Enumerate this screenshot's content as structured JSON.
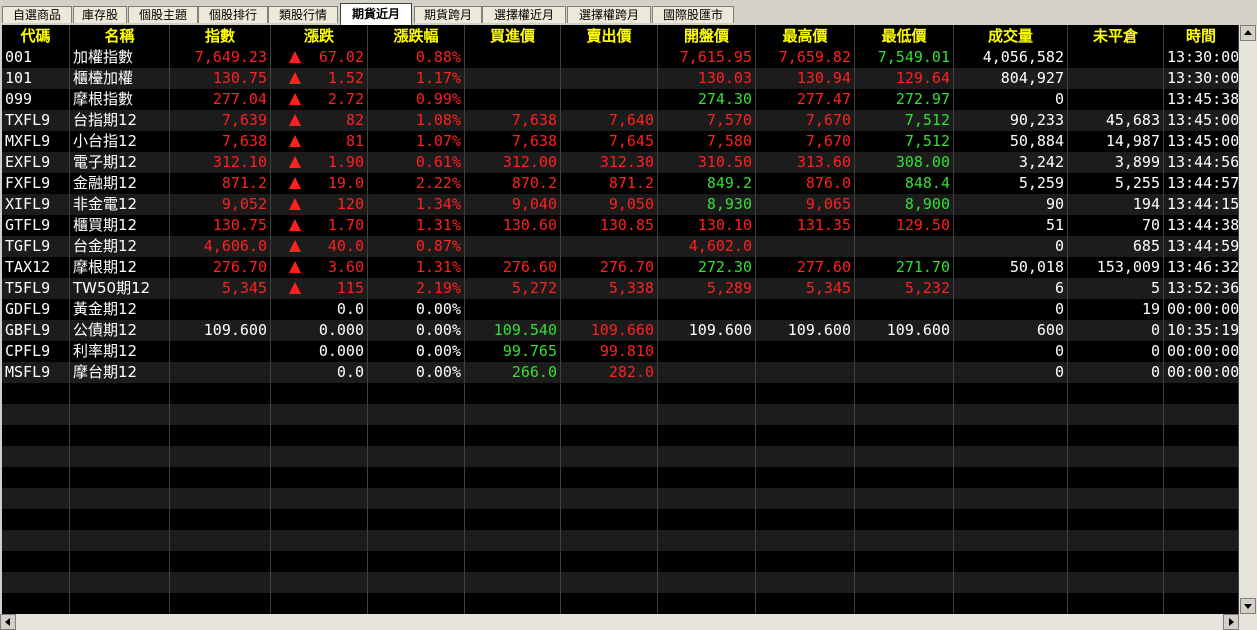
{
  "tabs": [
    {
      "label": "自選商品",
      "active": false
    },
    {
      "label": "庫存股",
      "active": false
    },
    {
      "label": "個股主題",
      "active": false
    },
    {
      "label": "個股排行",
      "active": false
    },
    {
      "label": "類股行情",
      "active": false
    },
    {
      "label": "期貨近月",
      "active": true
    },
    {
      "label": "期貨跨月",
      "active": false
    },
    {
      "label": "選擇權近月",
      "active": false
    },
    {
      "label": "選擇權跨月",
      "active": false
    },
    {
      "label": "國際股匯市",
      "active": false
    }
  ],
  "columns": [
    "代碼",
    "名稱",
    "指數",
    "漲跌",
    "漲跌幅",
    "買進價",
    "賣出價",
    "開盤價",
    "最高價",
    "最低價",
    "成交量",
    "未平倉",
    "時間"
  ],
  "colors": {
    "up": "#ff2020",
    "down": "#33e033",
    "flat": "#ffffff",
    "header": "#ffff00"
  },
  "rows": [
    {
      "code": "001",
      "name": "加權指數",
      "price": "7,649.23",
      "up": true,
      "change": "67.02",
      "pct": "0.88%",
      "bid": "",
      "ask": "",
      "open": "7,615.95",
      "high": "7,659.82",
      "low": "7,549.01",
      "volume": "4,056,582",
      "oi": "",
      "time": "13:30:00",
      "c": {
        "price": "red",
        "change": "red",
        "pct": "red",
        "bid": "white",
        "ask": "white",
        "open": "red",
        "high": "red",
        "low": "green"
      }
    },
    {
      "code": "101",
      "name": "櫃檯加權",
      "price": "130.75",
      "up": true,
      "change": "1.52",
      "pct": "1.17%",
      "bid": "",
      "ask": "",
      "open": "130.03",
      "high": "130.94",
      "low": "129.64",
      "volume": "804,927",
      "oi": "",
      "time": "13:30:00",
      "c": {
        "price": "red",
        "change": "red",
        "pct": "red",
        "bid": "white",
        "ask": "white",
        "open": "red",
        "high": "red",
        "low": "red"
      }
    },
    {
      "code": "099",
      "name": "摩根指數",
      "price": "277.04",
      "up": true,
      "change": "2.72",
      "pct": "0.99%",
      "bid": "",
      "ask": "",
      "open": "274.30",
      "high": "277.47",
      "low": "272.97",
      "volume": "0",
      "oi": "",
      "time": "13:45:38",
      "c": {
        "price": "red",
        "change": "red",
        "pct": "red",
        "bid": "white",
        "ask": "white",
        "open": "green",
        "high": "red",
        "low": "green"
      }
    },
    {
      "code": "TXFL9",
      "name": "台指期12",
      "price": "7,639",
      "up": true,
      "change": "82",
      "pct": "1.08%",
      "bid": "7,638",
      "ask": "7,640",
      "open": "7,570",
      "high": "7,670",
      "low": "7,512",
      "volume": "90,233",
      "oi": "45,683",
      "time": "13:45:00",
      "c": {
        "price": "red",
        "change": "red",
        "pct": "red",
        "bid": "red",
        "ask": "red",
        "open": "red",
        "high": "red",
        "low": "green"
      }
    },
    {
      "code": "MXFL9",
      "name": "小台指12",
      "price": "7,638",
      "up": true,
      "change": "81",
      "pct": "1.07%",
      "bid": "7,638",
      "ask": "7,645",
      "open": "7,580",
      "high": "7,670",
      "low": "7,512",
      "volume": "50,884",
      "oi": "14,987",
      "time": "13:45:00",
      "c": {
        "price": "red",
        "change": "red",
        "pct": "red",
        "bid": "red",
        "ask": "red",
        "open": "red",
        "high": "red",
        "low": "green"
      }
    },
    {
      "code": "EXFL9",
      "name": "電子期12",
      "price": "312.10",
      "up": true,
      "change": "1.90",
      "pct": "0.61%",
      "bid": "312.00",
      "ask": "312.30",
      "open": "310.50",
      "high": "313.60",
      "low": "308.00",
      "volume": "3,242",
      "oi": "3,899",
      "time": "13:44:56",
      "c": {
        "price": "red",
        "change": "red",
        "pct": "red",
        "bid": "red",
        "ask": "red",
        "open": "red",
        "high": "red",
        "low": "green"
      }
    },
    {
      "code": "FXFL9",
      "name": "金融期12",
      "price": "871.2",
      "up": true,
      "change": "19.0",
      "pct": "2.22%",
      "bid": "870.2",
      "ask": "871.2",
      "open": "849.2",
      "high": "876.0",
      "low": "848.4",
      "volume": "5,259",
      "oi": "5,255",
      "time": "13:44:57",
      "c": {
        "price": "red",
        "change": "red",
        "pct": "red",
        "bid": "red",
        "ask": "red",
        "open": "green",
        "high": "red",
        "low": "green"
      }
    },
    {
      "code": "XIFL9",
      "name": "非金電12",
      "price": "9,052",
      "up": true,
      "change": "120",
      "pct": "1.34%",
      "bid": "9,040",
      "ask": "9,050",
      "open": "8,930",
      "high": "9,065",
      "low": "8,900",
      "volume": "90",
      "oi": "194",
      "time": "13:44:15",
      "c": {
        "price": "red",
        "change": "red",
        "pct": "red",
        "bid": "red",
        "ask": "red",
        "open": "green",
        "high": "red",
        "low": "green"
      }
    },
    {
      "code": "GTFL9",
      "name": "櫃買期12",
      "price": "130.75",
      "up": true,
      "change": "1.70",
      "pct": "1.31%",
      "bid": "130.60",
      "ask": "130.85",
      "open": "130.10",
      "high": "131.35",
      "low": "129.50",
      "volume": "51",
      "oi": "70",
      "time": "13:44:38",
      "c": {
        "price": "red",
        "change": "red",
        "pct": "red",
        "bid": "red",
        "ask": "red",
        "open": "red",
        "high": "red",
        "low": "red"
      }
    },
    {
      "code": "TGFL9",
      "name": "台金期12",
      "price": "4,606.0",
      "up": true,
      "change": "40.0",
      "pct": "0.87%",
      "bid": "",
      "ask": "",
      "open": "4,602.0",
      "high": "",
      "low": "",
      "volume": "0",
      "oi": "685",
      "time": "13:44:59",
      "c": {
        "price": "red",
        "change": "red",
        "pct": "red",
        "bid": "white",
        "ask": "white",
        "open": "red",
        "high": "red",
        "low": "red"
      }
    },
    {
      "code": "TAX12",
      "name": "摩根期12",
      "price": "276.70",
      "up": true,
      "change": "3.60",
      "pct": "1.31%",
      "bid": "276.60",
      "ask": "276.70",
      "open": "272.30",
      "high": "277.60",
      "low": "271.70",
      "volume": "50,018",
      "oi": "153,009",
      "time": "13:46:32",
      "c": {
        "price": "red",
        "change": "red",
        "pct": "red",
        "bid": "red",
        "ask": "red",
        "open": "green",
        "high": "red",
        "low": "green"
      }
    },
    {
      "code": "T5FL9",
      "name": "TW50期12",
      "price": "5,345",
      "up": true,
      "change": "115",
      "pct": "2.19%",
      "bid": "5,272",
      "ask": "5,338",
      "open": "5,289",
      "high": "5,345",
      "low": "5,232",
      "volume": "6",
      "oi": "5",
      "time": "13:52:36",
      "c": {
        "price": "red",
        "change": "red",
        "pct": "red",
        "bid": "red",
        "ask": "red",
        "open": "red",
        "high": "red",
        "low": "red"
      }
    },
    {
      "code": "GDFL9",
      "name": "黃金期12",
      "price": "",
      "up": false,
      "change": "0.0",
      "pct": "0.00%",
      "bid": "",
      "ask": "",
      "open": "",
      "high": "",
      "low": "",
      "volume": "0",
      "oi": "19",
      "time": "00:00:00",
      "c": {
        "price": "white",
        "change": "white",
        "pct": "white",
        "bid": "white",
        "ask": "white",
        "open": "white",
        "high": "white",
        "low": "white"
      }
    },
    {
      "code": "GBFL9",
      "name": "公債期12",
      "price": "109.600",
      "up": false,
      "change": "0.000",
      "pct": "0.00%",
      "bid": "109.540",
      "ask": "109.660",
      "open": "109.600",
      "high": "109.600",
      "low": "109.600",
      "volume": "600",
      "oi": "0",
      "time": "10:35:19",
      "c": {
        "price": "white",
        "change": "white",
        "pct": "white",
        "bid": "green",
        "ask": "red",
        "open": "white",
        "high": "white",
        "low": "white"
      }
    },
    {
      "code": "CPFL9",
      "name": "利率期12",
      "price": "",
      "up": false,
      "change": "0.000",
      "pct": "0.00%",
      "bid": "99.765",
      "ask": "99.810",
      "open": "",
      "high": "",
      "low": "",
      "volume": "0",
      "oi": "0",
      "time": "00:00:00",
      "c": {
        "price": "white",
        "change": "white",
        "pct": "white",
        "bid": "green",
        "ask": "red",
        "open": "white",
        "high": "white",
        "low": "white"
      }
    },
    {
      "code": "MSFL9",
      "name": "摩台期12",
      "price": "",
      "up": false,
      "change": "0.0",
      "pct": "0.00%",
      "bid": "266.0",
      "ask": "282.0",
      "open": "",
      "high": "",
      "low": "",
      "volume": "0",
      "oi": "0",
      "time": "00:00:00",
      "c": {
        "price": "white",
        "change": "white",
        "pct": "white",
        "bid": "green",
        "ask": "red",
        "open": "white",
        "high": "white",
        "low": "white"
      }
    }
  ]
}
